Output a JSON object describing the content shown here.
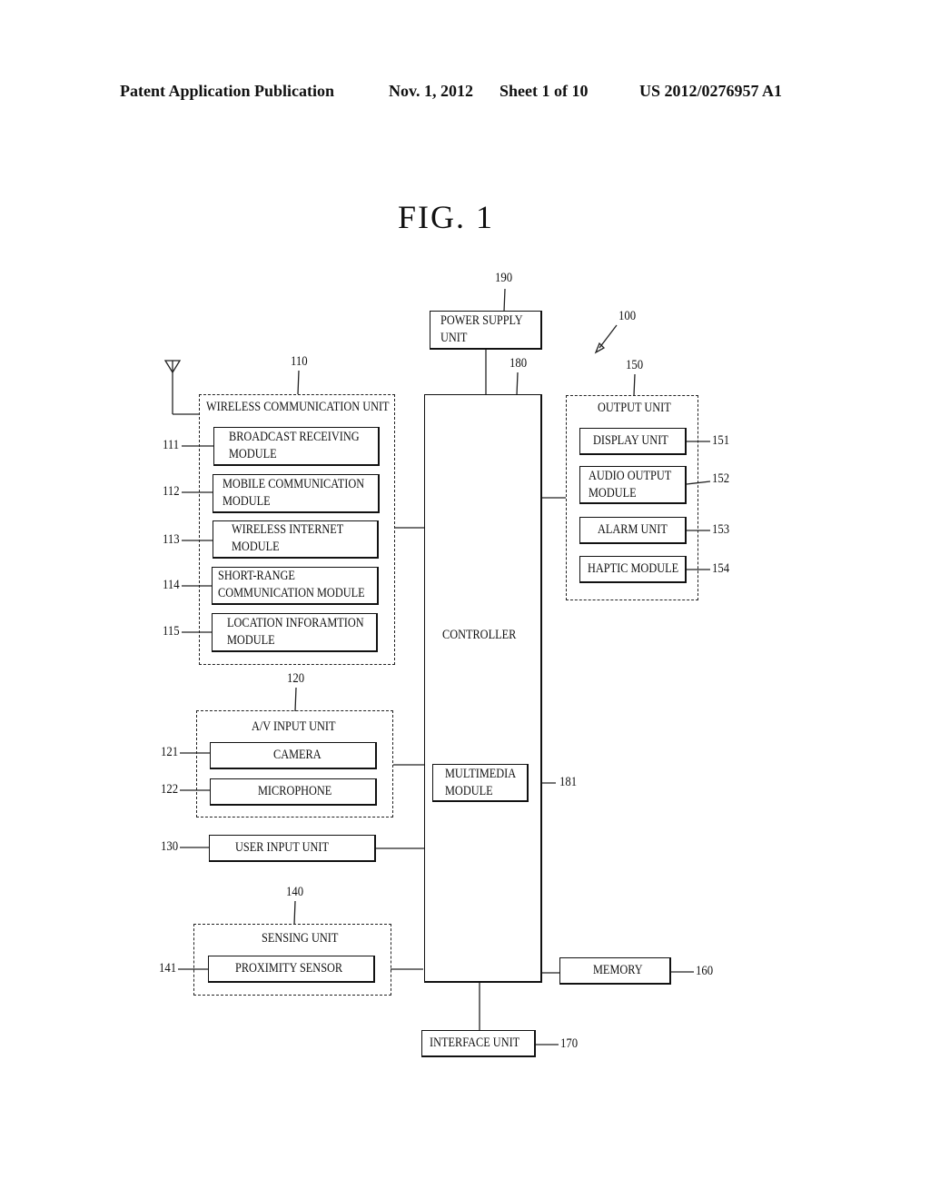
{
  "header": {
    "publication": "Patent Application Publication",
    "date": "Nov. 1, 2012",
    "sheet": "Sheet 1 of 10",
    "number": "US 2012/0276957 A1"
  },
  "figure": {
    "title": "FIG.  1",
    "device_ref": "100"
  },
  "power_supply": {
    "ref": "190",
    "label_line1": "POWER SUPPLY",
    "label_line2": "UNIT"
  },
  "controller": {
    "ref": "180",
    "label": "CONTROLLER",
    "multimedia": {
      "ref": "181",
      "label_line1": "MULTIMEDIA",
      "label_line2": "MODULE"
    }
  },
  "wireless_unit": {
    "ref": "110",
    "label": "WIRELESS COMMUNICATION UNIT",
    "modules": [
      {
        "ref": "111",
        "line1": "BROADCAST RECEIVING",
        "line2": "MODULE"
      },
      {
        "ref": "112",
        "line1": "MOBILE COMMUNICATION",
        "line2": "MODULE"
      },
      {
        "ref": "113",
        "line1": "WIRELESS INTERNET",
        "line2": "MODULE"
      },
      {
        "ref": "114",
        "line1": "SHORT-RANGE",
        "line2": "COMMUNICATION MODULE"
      },
      {
        "ref": "115",
        "line1": "LOCATION INFORAMTION",
        "line2": "MODULE"
      }
    ]
  },
  "av_input": {
    "ref": "120",
    "label": "A/V INPUT UNIT",
    "modules": [
      {
        "ref": "121",
        "label": "CAMERA"
      },
      {
        "ref": "122",
        "label": "MICROPHONE"
      }
    ]
  },
  "user_input": {
    "ref": "130",
    "label": "USER INPUT UNIT"
  },
  "sensing_unit": {
    "ref": "140",
    "label": "SENSING UNIT",
    "modules": [
      {
        "ref": "141",
        "label": "PROXIMITY SENSOR"
      }
    ]
  },
  "output_unit": {
    "ref": "150",
    "label": "OUTPUT UNIT",
    "modules": [
      {
        "ref": "151",
        "line1": "DISPLAY UNIT",
        "line2": ""
      },
      {
        "ref": "152",
        "line1": "AUDIO OUTPUT",
        "line2": "MODULE"
      },
      {
        "ref": "153",
        "line1": "ALARM UNIT",
        "line2": ""
      },
      {
        "ref": "154",
        "line1": "HAPTIC MODULE",
        "line2": ""
      }
    ]
  },
  "memory": {
    "ref": "160",
    "label": "MEMORY"
  },
  "interface_unit": {
    "ref": "170",
    "label": "INTERFACE UNIT"
  }
}
